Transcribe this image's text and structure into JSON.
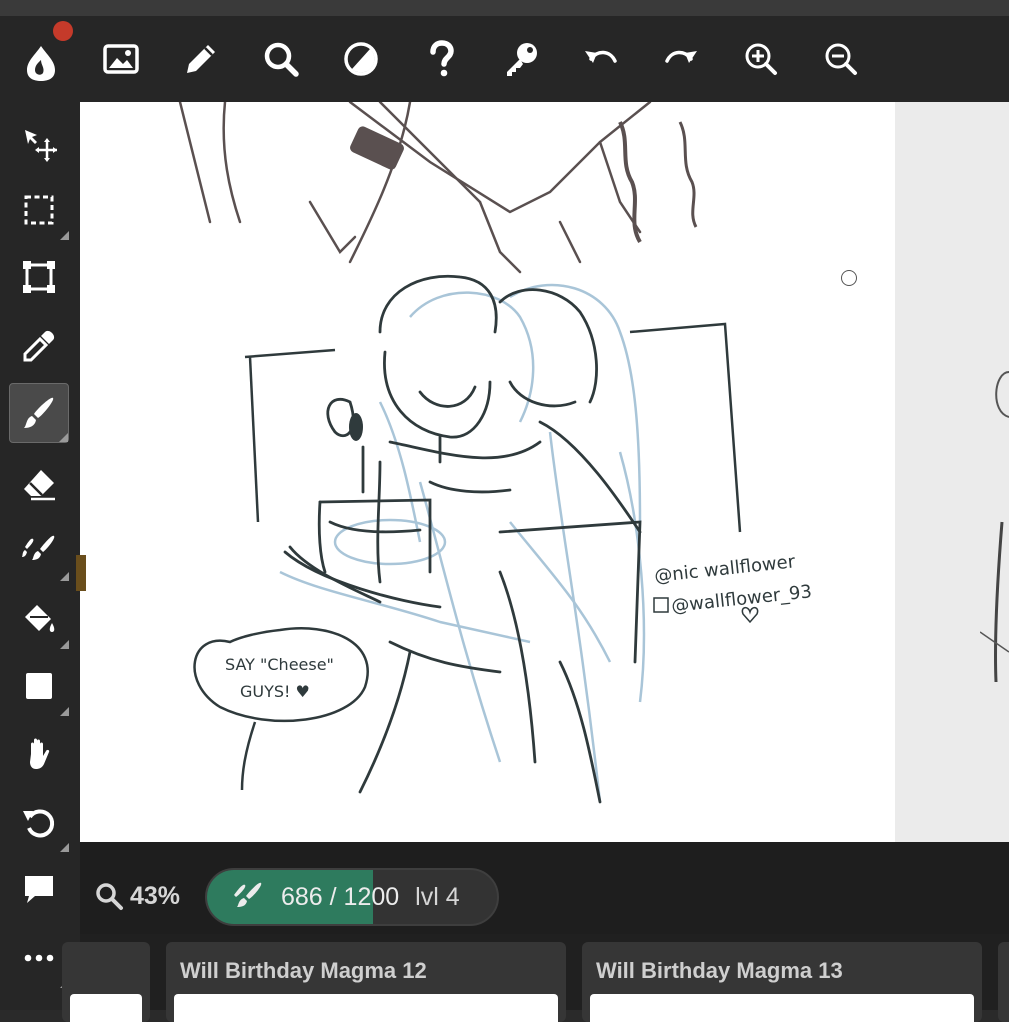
{
  "toolbar": {
    "icons": [
      "app-logo-icon",
      "image-icon",
      "pencil-icon",
      "search-icon",
      "contrast-icon",
      "help-icon",
      "key-icon",
      "undo-icon",
      "redo-icon",
      "zoom-in-icon",
      "zoom-out-icon"
    ]
  },
  "sidebar": {
    "tools": [
      "move-tool",
      "selection-tool",
      "transform-tool",
      "eyedropper-tool",
      "brush-tool",
      "eraser-tool",
      "smudge-tool",
      "fill-tool",
      "shape-tool",
      "hand-tool",
      "rotate-tool",
      "comment-tool",
      "more-tool"
    ],
    "active_tool": "brush-tool"
  },
  "status": {
    "zoom": "43%",
    "progress_count": "686 / 1200",
    "progress_level": "lvl 4",
    "progress_fraction": 0.572
  },
  "gallery": {
    "cards": [
      {
        "title": ""
      },
      {
        "title": "Will Birthday Magma 12"
      },
      {
        "title": "Will Birthday Magma 13"
      }
    ]
  },
  "artwork": {
    "speech_bubble": [
      "SAY \"Cheese\"",
      "GUYS! ♥"
    ],
    "signature_lines": [
      "@nic wallflower",
      "@wallflower_93"
    ]
  },
  "colors": {
    "accent_green": "#2e7b5e",
    "notification_red": "#c53a2a",
    "toolbar_bg": "#262626"
  }
}
